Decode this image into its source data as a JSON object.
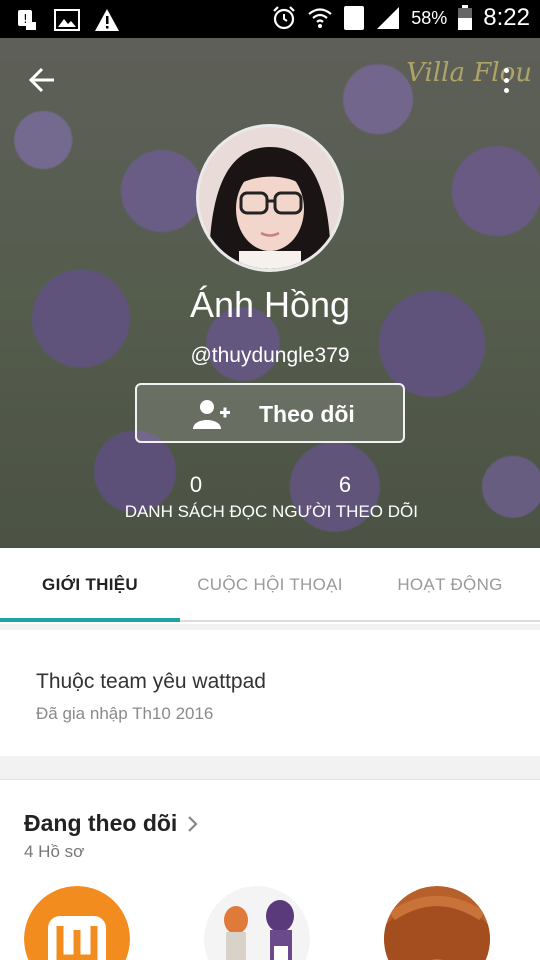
{
  "status_bar": {
    "battery_percent": "58%",
    "time": "8:22",
    "sim_slot": "2",
    "icons_left": [
      "notification-alert-icon",
      "image-icon",
      "warning-icon"
    ],
    "icons_right": [
      "alarm-icon",
      "wifi-icon",
      "sim-icon",
      "signal-icon",
      "battery-icon"
    ]
  },
  "header": {
    "watermark": "Villa Flou",
    "name": "Ánh Hồng",
    "username": "@thuydungle379",
    "follow_label": "Theo dõi",
    "stats": [
      {
        "value": "0",
        "label": "DANH SÁCH ĐỌC"
      },
      {
        "value": "6",
        "label": "NGƯỜI THEO DÕI"
      }
    ]
  },
  "tabs": [
    {
      "label": "GIỚI THIỆU",
      "active": true
    },
    {
      "label": "CUỘC HỘI THOẠI",
      "active": false
    },
    {
      "label": "HOẠT ĐỘNG",
      "active": false
    }
  ],
  "about": {
    "description": "Thuộc team yêu wattpad",
    "joined": "Đã gia nhập Th10 2016"
  },
  "following": {
    "title": "Đang theo dõi",
    "count": "4 Hồ sơ"
  },
  "colors": {
    "accent": "#20a4a3",
    "wattpad_orange": "#f28c1e"
  }
}
